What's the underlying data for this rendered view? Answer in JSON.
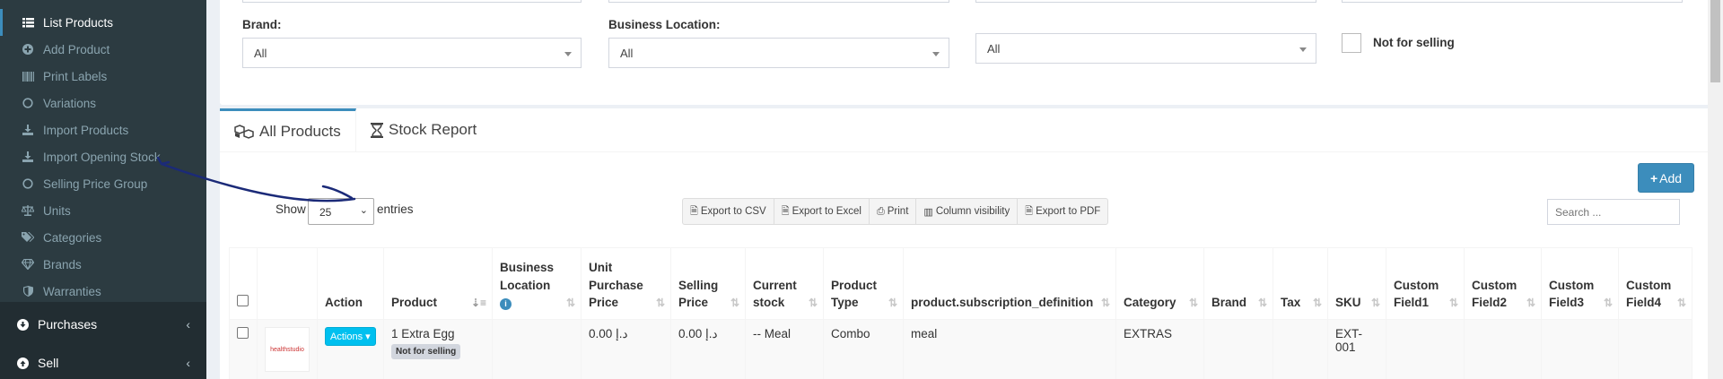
{
  "sidebar": {
    "items": [
      {
        "label": "List Products",
        "icon": "list-icon"
      },
      {
        "label": "Add Product",
        "icon": "plus-circle-icon"
      },
      {
        "label": "Print Labels",
        "icon": "barcode-icon"
      },
      {
        "label": "Variations",
        "icon": "circle-icon"
      },
      {
        "label": "Import Products",
        "icon": "download-icon"
      },
      {
        "label": "Import Opening Stock",
        "icon": "download-icon"
      },
      {
        "label": "Selling Price Group",
        "icon": "circle-icon"
      },
      {
        "label": "Units",
        "icon": "balance-scale-icon"
      },
      {
        "label": "Categories",
        "icon": "tags-icon"
      },
      {
        "label": "Brands",
        "icon": "gem-icon"
      },
      {
        "label": "Warranties",
        "icon": "shield-icon"
      }
    ],
    "sections": [
      {
        "label": "Purchases",
        "icon": "arrow-circle-down-icon"
      },
      {
        "label": "Sell",
        "icon": "arrow-circle-up-icon"
      }
    ]
  },
  "filters": {
    "brand_label": "Brand:",
    "brand_value": "All",
    "location_label": "Business Location:",
    "location_value": "All",
    "third_value": "All",
    "not_for_selling_label": "Not for selling"
  },
  "tabs": {
    "all_products": "All Products",
    "stock_report": "Stock Report"
  },
  "toolbar": {
    "add_label": "Add",
    "show_label": "Show",
    "entries_value": "25",
    "entries_label": "entries",
    "export_csv": "Export to CSV",
    "export_excel": "Export to Excel",
    "print": "Print",
    "column_visibility": "Column visibility",
    "export_pdf": "Export to PDF",
    "search_placeholder": "Search ..."
  },
  "table": {
    "headers": {
      "action": "Action",
      "product": "Product",
      "business_location": "Business Location",
      "unit_purchase_price": "Unit Purchase Price",
      "selling_price": "Selling Price",
      "current_stock": "Current stock",
      "product_type": "Product Type",
      "subscription": "product.subscription_definition",
      "category": "Category",
      "brand": "Brand",
      "tax": "Tax",
      "sku": "SKU",
      "custom1": "Custom Field1",
      "custom2": "Custom Field2",
      "custom3": "Custom Field3",
      "custom4": "Custom Field4"
    },
    "rows": [
      {
        "thumb_text": "healthstudio",
        "actions": "Actions",
        "product": "1 Extra Egg",
        "badge": "Not for selling",
        "business_location": "",
        "unit_purchase_price": "0.00 د.إ",
        "selling_price": "0.00 د.إ",
        "current_stock": "-- Meal",
        "product_type": "Combo",
        "subscription": "meal",
        "category": "EXTRAS",
        "brand": "",
        "tax": "",
        "sku": "EXT-001"
      }
    ]
  },
  "colors": {
    "sidebar_bg": "#222d32",
    "primary": "#3c8dbc",
    "actions_btn": "#00c0ef"
  }
}
